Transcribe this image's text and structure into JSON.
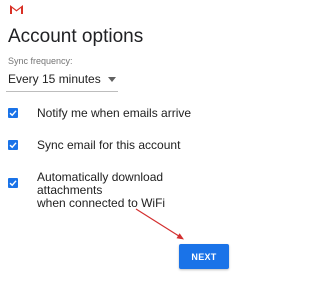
{
  "app": {
    "logo_icon": "gmail-logo-icon",
    "brand_color": "#d93025"
  },
  "page": {
    "title": "Account options"
  },
  "sync": {
    "label": "Sync frequency:",
    "selected": "Every 15 minutes",
    "icon": "dropdown-arrow-icon"
  },
  "options": [
    {
      "label_lines": [
        "Notify me when emails arrive"
      ],
      "checked": true
    },
    {
      "label_lines": [
        "Sync email for this account"
      ],
      "checked": true
    },
    {
      "label_lines": [
        "Automatically download attachments",
        "when connected to WiFi"
      ],
      "checked": true
    }
  ],
  "actions": {
    "next_label": "NEXT"
  },
  "colors": {
    "accent": "#1a73e8",
    "annotation_arrow": "#d32f2f"
  }
}
